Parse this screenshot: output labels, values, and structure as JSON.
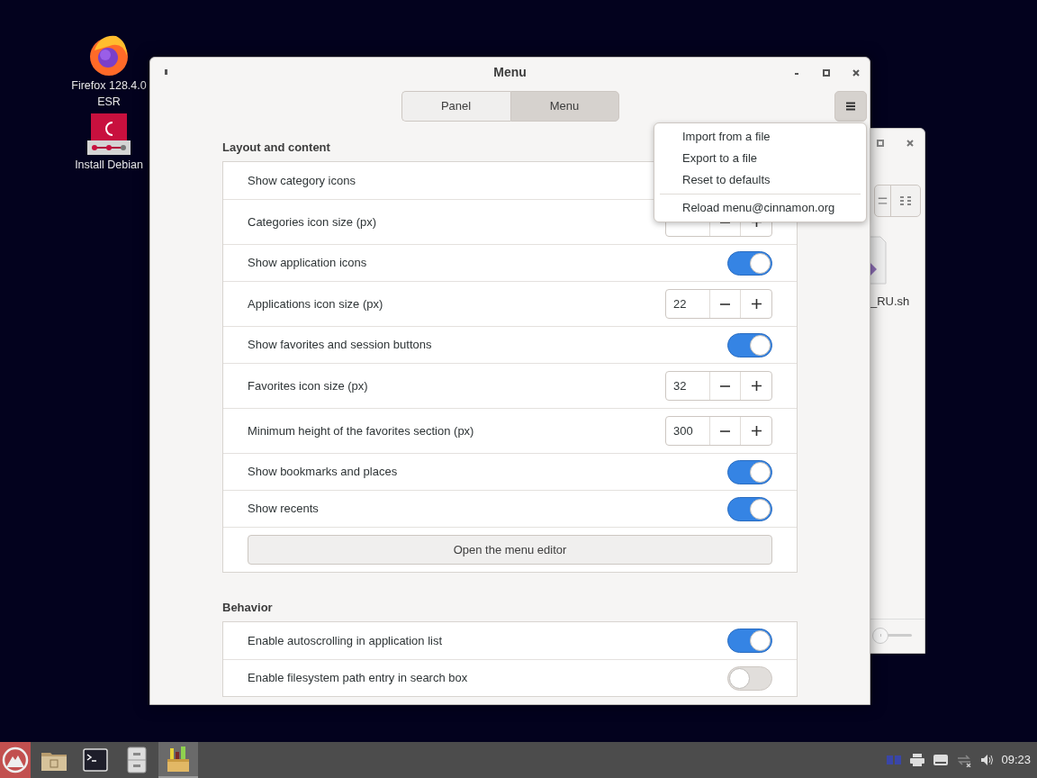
{
  "desktop_icons": [
    {
      "kind": "firefox",
      "lines": [
        "Firefox 128.4.0",
        "ESR"
      ]
    },
    {
      "kind": "debian",
      "lines": [
        "Install Debian"
      ]
    }
  ],
  "background_window": {
    "file_label": "_RU.sh",
    "zoom_slider": {
      "level": 0
    }
  },
  "window": {
    "title": "Menu",
    "tabs": [
      {
        "label": "Panel",
        "selected": false
      },
      {
        "label": "Menu",
        "selected": true
      }
    ],
    "sections": [
      {
        "title": "Layout and content",
        "rows": [
          {
            "kind": "switch",
            "label": "Show category icons"
          },
          {
            "kind": "spin",
            "label": "Categories icon size (px)"
          },
          {
            "kind": "switch",
            "label": "Show application icons",
            "on": true
          },
          {
            "kind": "spin",
            "label": "Applications icon size (px)",
            "value": "22"
          },
          {
            "kind": "switch",
            "label": "Show favorites and session buttons",
            "on": true
          },
          {
            "kind": "spin",
            "label": "Favorites icon size (px)",
            "value": "32"
          },
          {
            "kind": "spin",
            "label": "Minimum height of the favorites section (px)",
            "value": "300"
          },
          {
            "kind": "switch",
            "label": "Show bookmarks and places",
            "on": true
          },
          {
            "kind": "switch",
            "label": "Show recents",
            "on": true
          },
          {
            "kind": "button",
            "label": "Open the menu editor"
          }
        ]
      },
      {
        "title": "Behavior",
        "rows": [
          {
            "kind": "switch",
            "label": "Enable autoscrolling in application list",
            "on": true
          },
          {
            "kind": "switch",
            "label": "Enable filesystem path entry in search box",
            "on": false
          }
        ]
      }
    ],
    "popup_menu": [
      {
        "label": "Import from a file",
        "separator_before": false
      },
      {
        "label": "Export to a file",
        "separator_before": false
      },
      {
        "label": "Reset to defaults",
        "separator_before": false
      },
      {
        "label": "Reload menu@cinnamon.org",
        "separator_before": true
      }
    ]
  },
  "taskbar": {
    "apps": [
      {
        "kind": "folder",
        "active": false
      },
      {
        "kind": "terminal",
        "active": false
      },
      {
        "kind": "cabinet",
        "active": false
      },
      {
        "kind": "settings",
        "active": true
      }
    ],
    "clock": "09:23"
  }
}
